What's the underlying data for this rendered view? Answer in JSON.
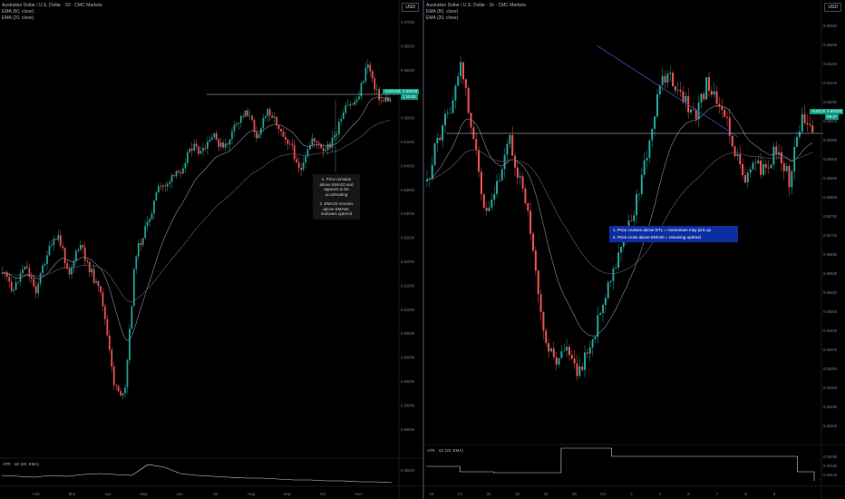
{
  "left_pane": {
    "title": "Australian Dollar / U.S. Dollar · 1D · CMC Markets",
    "ema_slow": "EMA (60, close)",
    "ema_fast": "EMA (20, close)",
    "currency": "USD",
    "price_ticks": [
      "0.67000",
      "0.66500",
      "0.66000",
      "0.65500",
      "0.65000",
      "0.64500",
      "0.64000",
      "0.63500",
      "0.63000",
      "0.62500",
      "0.62000",
      "0.61500",
      "0.61000",
      "0.60500",
      "0.60000",
      "0.59500",
      "0.59000",
      "0.58500"
    ],
    "atr_tick": "0.00500",
    "time_ticks": [
      "Feb",
      "Mar",
      "Apr",
      "May",
      "Jun",
      "Jul",
      "Aug",
      "Sep",
      "Oct",
      "Nov"
    ],
    "symbol_tag": "AUDUSD",
    "price_tag": "0.66029",
    "price_sub": "1:16:01",
    "atr_label": "ATR · 1D (20, EMA)",
    "annotation": [
      "1. Price remains above EMA20 and appears to be accelerating",
      "2. EMA20 remains above EMA60, indicates uptrend"
    ]
  },
  "right_pane": {
    "title": "Australian Dollar / U.S. Dollar · 1h · CMC Markets",
    "ema_slow": "EMA (60, close)",
    "ema_fast": "EMA (20, close)",
    "currency": "USD",
    "price_ticks": [
      "0.66250",
      "0.66200",
      "0.66150",
      "0.66100",
      "0.66050",
      "0.66000",
      "0.65950",
      "0.65900",
      "0.65850",
      "0.65800",
      "0.65750",
      "0.65700",
      "0.65650",
      "0.65600",
      "0.65550",
      "0.65500",
      "0.65450",
      "0.65400",
      "0.65350",
      "0.65300",
      "0.65250",
      "0.65200"
    ],
    "atr_ticks": [
      "0.00480",
      "0.00460",
      "0.00440"
    ],
    "time_ticks": [
      "23",
      "24",
      "25",
      "26",
      "29",
      "30",
      "Oct",
      "2",
      "3",
      "6",
      "7",
      "8",
      "9"
    ],
    "symbol_tag": "AUDUSD",
    "price_tag": "0.66029",
    "price_sub": "08:47",
    "atr_label": "ATR · 1D (20, EMA)",
    "note_1": "1. Price crosses above DTL = momentum may pick up",
    "note_2": "2. Price cross above EMA20 = resuming uptrend"
  },
  "colors": {
    "up": "#26a69a",
    "down": "#ef5350",
    "ema": "#787b86",
    "trendline": "#3949ab",
    "tag": "#089981"
  }
}
